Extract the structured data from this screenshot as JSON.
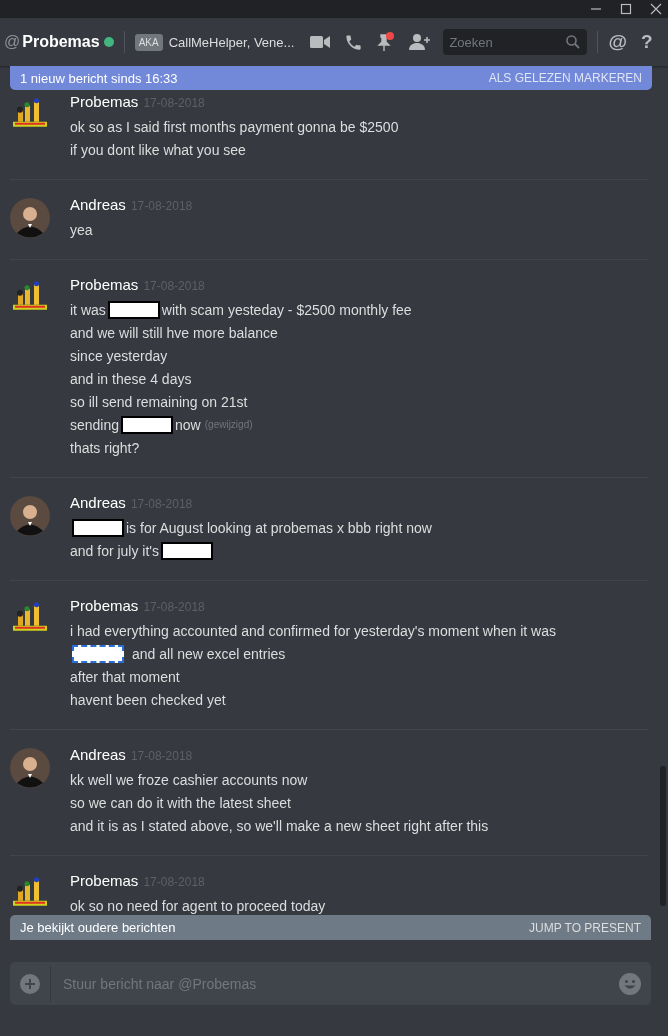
{
  "header": {
    "at": "@",
    "name": "Probemas",
    "online": true,
    "aka_badge": "AKA",
    "aka_names": "CallMeHelper, Vene...",
    "pin_unread": true,
    "search": {
      "placeholder": "Zoeken"
    },
    "mentions": "@",
    "help": "?"
  },
  "new_banner": {
    "text": "1 nieuw bericht sinds 16:33",
    "action": "ALS GELEZEN MARKEREN"
  },
  "messages": [
    {
      "author": "Probemas",
      "avatar": {
        "kind": "logo"
      },
      "date": "17-08-2018",
      "lines": [
        [
          {
            "kind": "text",
            "text": "ok so as I said first months payment gonna be $2500"
          }
        ],
        [
          {
            "kind": "text",
            "text": "if you dont like what you see"
          }
        ]
      ]
    },
    {
      "author": "Andreas",
      "avatar": {
        "kind": "person"
      },
      "date": "17-08-2018",
      "lines": [
        [
          {
            "kind": "text",
            "text": "yea"
          }
        ]
      ]
    },
    {
      "author": "Probemas",
      "avatar": {
        "kind": "logo"
      },
      "date": "17-08-2018",
      "lines": [
        [
          {
            "kind": "text",
            "text": "it was"
          },
          {
            "kind": "redacted",
            "selected": false
          },
          {
            "kind": "text",
            "text": "with scam yesteday - $2500 monthly fee"
          }
        ],
        [
          {
            "kind": "text",
            "text": "and we will still hve more balance"
          }
        ],
        [
          {
            "kind": "text",
            "text": "since yesterday"
          }
        ],
        [
          {
            "kind": "text",
            "text": "and in these 4 days"
          }
        ],
        [
          {
            "kind": "text",
            "text": "so ill send remaining on 21st"
          }
        ],
        [
          {
            "kind": "text",
            "text": "sending"
          },
          {
            "kind": "redacted",
            "selected": false
          },
          {
            "kind": "text",
            "text": "now"
          },
          {
            "kind": "edited",
            "text": "(gewijzigd)"
          }
        ],
        [
          {
            "kind": "text",
            "text": "thats right?"
          }
        ]
      ]
    },
    {
      "author": "Andreas",
      "avatar": {
        "kind": "person"
      },
      "date": "17-08-2018",
      "lines": [
        [
          {
            "kind": "redacted",
            "selected": false
          },
          {
            "kind": "text",
            "text": "is for August looking at probemas x bbb right now"
          }
        ],
        [
          {
            "kind": "text",
            "text": "and for july it's"
          },
          {
            "kind": "redacted",
            "selected": false
          }
        ]
      ]
    },
    {
      "author": "Probemas",
      "avatar": {
        "kind": "logo"
      },
      "date": "17-08-2018",
      "lines": [
        [
          {
            "kind": "text",
            "text": "i had everything accounted and confirmed for yesterday's moment when it was"
          }
        ],
        [
          {
            "kind": "redacted",
            "selected": true
          },
          {
            "kind": "text",
            "text": "and all new excel entries"
          }
        ],
        [
          {
            "kind": "text",
            "text": "after that moment"
          }
        ],
        [
          {
            "kind": "text",
            "text": "havent been checked yet"
          }
        ]
      ]
    },
    {
      "author": "Andreas",
      "avatar": {
        "kind": "person"
      },
      "date": "17-08-2018",
      "lines": [
        [
          {
            "kind": "text",
            "text": "kk well we froze cashier accounts now"
          }
        ],
        [
          {
            "kind": "text",
            "text": "so we can do it with the latest sheet"
          }
        ],
        [
          {
            "kind": "text",
            "text": "and it is as I stated above, so we'll make a new sheet right after this"
          }
        ]
      ]
    },
    {
      "author": "Probemas",
      "avatar": {
        "kind": "logo"
      },
      "date": "17-08-2018",
      "lines": [
        [
          {
            "kind": "text",
            "text": "ok so no need for agent to proceed today"
          }
        ]
      ]
    }
  ],
  "old_banner": {
    "text": "Je bekijkt oudere berichten",
    "action": "JUMP TO PRESENT"
  },
  "composer": {
    "placeholder": "Stuur bericht naar @Probemas"
  }
}
